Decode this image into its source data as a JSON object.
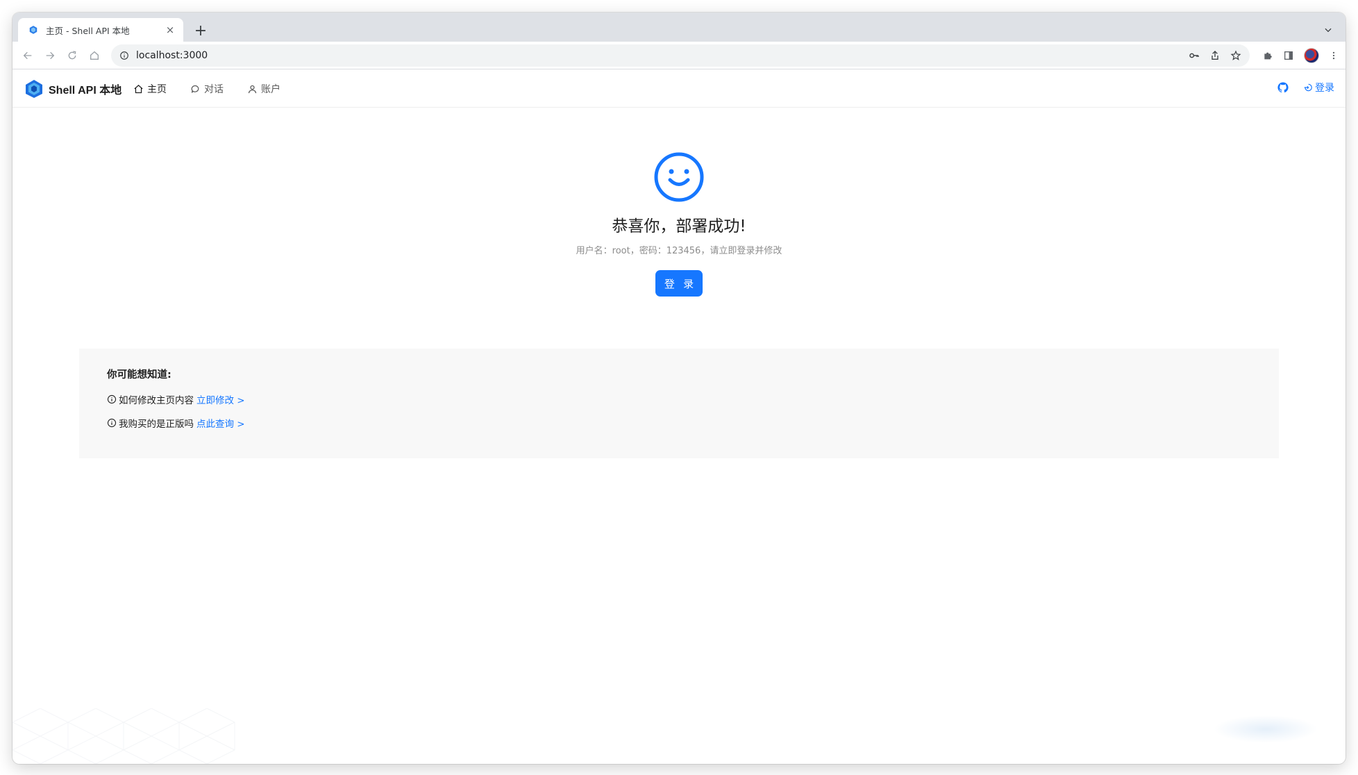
{
  "browser": {
    "tab_title": "主页 - Shell API 本地",
    "tab_close": "×",
    "new_tab": "+",
    "url": "localhost:3000"
  },
  "app": {
    "brand": "Shell API 本地",
    "nav": [
      {
        "label": "主页",
        "icon": "home-icon"
      },
      {
        "label": "对话",
        "icon": "chat-icon"
      },
      {
        "label": "账户",
        "icon": "user-icon"
      }
    ],
    "login_label": "登录"
  },
  "hero": {
    "title": "恭喜你，部署成功!",
    "subtitle": "用户名：root，密码：123456，请立即登录并修改",
    "button_label": "登 录"
  },
  "faq": {
    "title": "你可能想知道:",
    "items": [
      {
        "question": "如何修改主页内容",
        "link": "立即修改 >"
      },
      {
        "question": "我购买的是正版吗",
        "link": "点此查询 >"
      }
    ]
  },
  "colors": {
    "primary": "#1677ff",
    "faq_bg": "#f8f8f8"
  }
}
